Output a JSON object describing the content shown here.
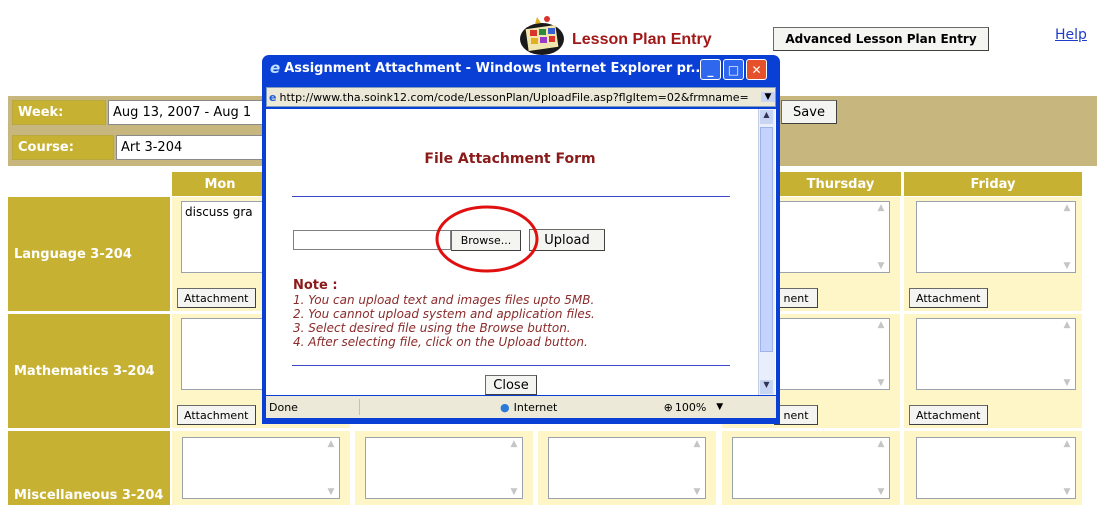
{
  "header": {
    "title": "Lesson Plan Entry",
    "advanced_button": "Advanced Lesson Plan Entry",
    "help_link": "Help"
  },
  "week": {
    "label": "Week:",
    "value": "Aug 13, 2007 - Aug 1"
  },
  "course": {
    "label": "Course:",
    "value": "Art 3-204"
  },
  "save_button": "Save",
  "days": [
    "Mon",
    "Thursday",
    "Friday"
  ],
  "rows": [
    {
      "label": "Language 3-204",
      "monday_text": "discuss gra"
    },
    {
      "label": "Mathematics 3-204",
      "monday_text": ""
    },
    {
      "label": "Miscellaneous 3-204",
      "monday_text": ""
    }
  ],
  "attachment_label": "Attachment",
  "attachment_partial": "nent",
  "popup": {
    "title": "Assignment Attachment - Windows Internet Explorer pr...",
    "address": "http://www.tha.soink12.com/code/LessonPlan/UploadFile.asp?flgItem=02&frmname=",
    "form_title": "File Attachment Form",
    "browse_button": "Browse...",
    "upload_button": "Upload",
    "note_heading": "Note :",
    "notes": [
      "1. You can upload text and images files upto 5MB.",
      "2. You cannot upload system and application files.",
      "3. Select desired file using the Browse button.",
      "4. After selecting file, click on the Upload button."
    ],
    "close_button": "Close",
    "status_done": "Done",
    "status_zone": "Internet",
    "zoom": "100%"
  },
  "colors": {
    "band": "#c7b77f",
    "gold": "#c7b133",
    "cell": "#fff6c8",
    "title_red": "#a01818",
    "popup_blue": "#0a3fd6",
    "highlight_circle": "#e01010"
  }
}
